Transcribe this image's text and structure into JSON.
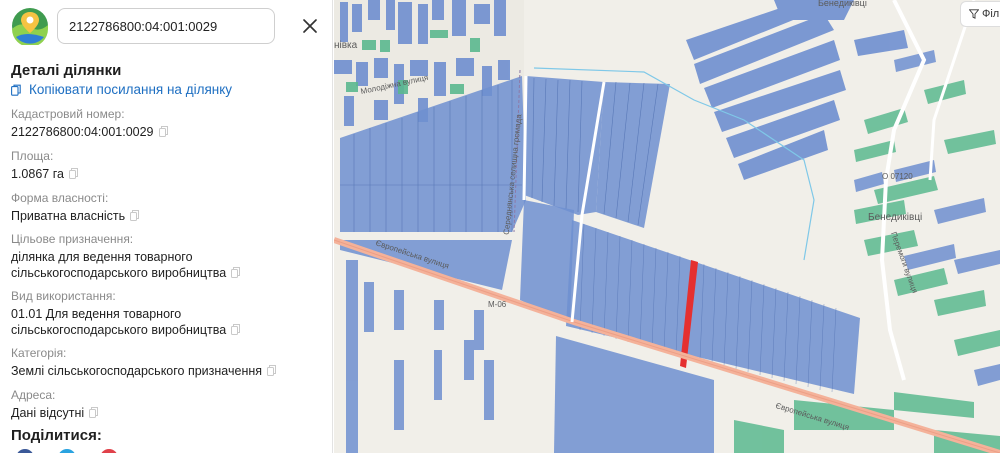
{
  "search": {
    "value": "2122786800:04:001:0029"
  },
  "details": {
    "title": "Деталі ділянки",
    "copy_link_label": "Копіювати посилання на ділянку"
  },
  "fields": [
    {
      "label": "Кадастровий номер:",
      "value": "2122786800:04:001:0029"
    },
    {
      "label": "Площа:",
      "value": "1.0867 га"
    },
    {
      "label": "Форма власності:",
      "value": "Приватна власність"
    },
    {
      "label": "Цільове призначення:",
      "value": "ділянка для ведення товарного сільськогосподарського виробництва"
    },
    {
      "label": "Вид використання:",
      "value": "01.01 Для ведення товарного сільськогосподарського виробництва"
    },
    {
      "label": "Категорія:",
      "value": "Землі сільськогосподарського призначення"
    },
    {
      "label": "Адреса:",
      "value": "Дані відсутні"
    }
  ],
  "share": {
    "title": "Поділитися:"
  },
  "map": {
    "filter_label": "Філ",
    "labels": {
      "village_top": "Бенедиківці",
      "village_right": "Бенедиківці",
      "road_m06": "М-06",
      "road_o07120": "О 07120",
      "street_european_1": "Європейська вулиця",
      "street_european_2": "Європейська вулиця",
      "street_peremohy": "Перемоги вулиця",
      "street_molodizhna": "Молодіжна вулиця",
      "boundary": "Середнянська селищна громада",
      "top_left_fragment": "нівка"
    }
  },
  "colors": {
    "accent_link": "#1e6fc2",
    "parcel_blue": "#6f8fd0",
    "parcel_green": "#5bb98f",
    "selected_parcel": "#e53030",
    "map_bg": "#f1efe9",
    "road": "#f4b29a"
  }
}
